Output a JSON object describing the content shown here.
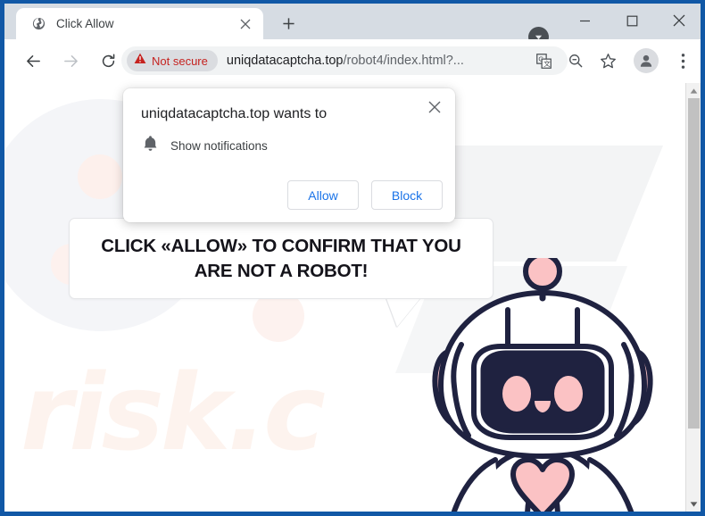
{
  "browser": {
    "tab": {
      "title": "Click Allow",
      "favicon": "globe-icon",
      "close_icon": "close-icon"
    },
    "new_tab_icon": "plus-icon",
    "tab_search_icon": "chevron-down-icon",
    "window_controls": {
      "minimize": "minimize-icon",
      "maximize": "maximize-icon",
      "close": "close-icon"
    },
    "nav": {
      "back": "arrow-left-icon",
      "forward": "arrow-right-icon",
      "reload": "reload-icon"
    },
    "omnibox": {
      "security_label": "Not secure",
      "security_icon": "warning-triangle-icon",
      "url_main": "uniqdatacaptcha.top",
      "url_path": "/robot4/index.html?...",
      "translate_icon": "translate-icon",
      "zoom_icon": "zoom-out-icon",
      "bookmark_icon": "star-icon",
      "profile_icon": "person-icon",
      "menu_icon": "three-dot-menu-icon"
    },
    "scrollbar": {
      "up_icon": "triangle-up-icon",
      "down_icon": "triangle-down-icon"
    }
  },
  "permission_dialog": {
    "title": "uniqdatacaptcha.top wants to",
    "permission_icon": "bell-icon",
    "permission_label": "Show notifications",
    "allow_label": "Allow",
    "block_label": "Block",
    "close_icon": "close-icon"
  },
  "page": {
    "bubble_text": "CLICK «ALLOW» TO CONFIRM THAT YOU ARE NOT A ROBOT!",
    "watermark_text": "risk.c",
    "robot_alt": "robot-mascot"
  },
  "colors": {
    "window_frame": "#1158a6",
    "tabstrip": "#d6dce3",
    "not_secure_red": "#c5221f",
    "link_blue": "#1a73e8",
    "robot_outline": "#1f2240",
    "robot_pink": "#fbc2c4",
    "watermark_pink": "#fdf3ee"
  }
}
